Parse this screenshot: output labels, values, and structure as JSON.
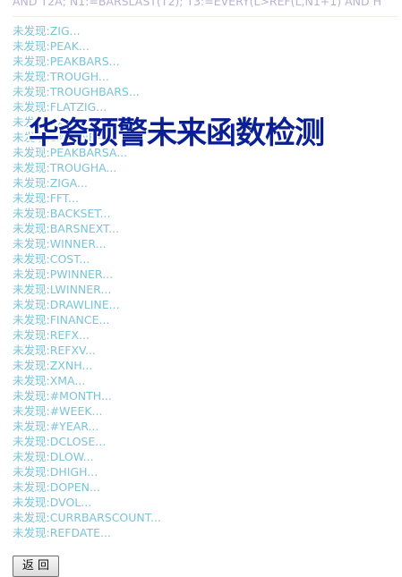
{
  "code_line": "AND T2A; N1:=BARSLAST(T2); T3:=EVERY(L>REF(L,N1+1) AND H",
  "overlay_title": "华瓷预警未来函数检测",
  "results": [
    "未发现:ZIG...",
    "未发现:PEAK...",
    "未发现:PEAKBARS...",
    "未发现:TROUGH...",
    "未发现:TROUGHBARS...",
    "未发现:FLATZIG...",
    "未发现:BACKSET...",
    "未发现:BARSNEXT...",
    "未发现:PEAKBARSA...",
    "未发现:TROUGHA...",
    "未发现:ZIGA...",
    "未发现:FFT...",
    "未发现:BACKSET...",
    "未发现:BARSNEXT...",
    "未发现:WINNER...",
    "未发现:COST...",
    "未发现:PWINNER...",
    "未发现:LWINNER...",
    "未发现:DRAWLINE...",
    "未发现:FINANCE...",
    "未发现:REFX...",
    "未发现:REFXV...",
    "未发现:ZXNH...",
    "未发现:XMA...",
    "未发现:#MONTH...",
    "未发现:#WEEK...",
    "未发现:#YEAR...",
    "未发现:DCLOSE...",
    "未发现:DLOW...",
    "未发现:DHIGH...",
    "未发现:DOPEN...",
    "未发现:DVOL...",
    "未发现:CURRBARSCOUNT...",
    "未发现:REFDATE..."
  ],
  "back_label": "返 回",
  "colors": {
    "result_text": "#7cc4d7",
    "title": "#0b1f95",
    "code_text": "#b9b2cf"
  }
}
